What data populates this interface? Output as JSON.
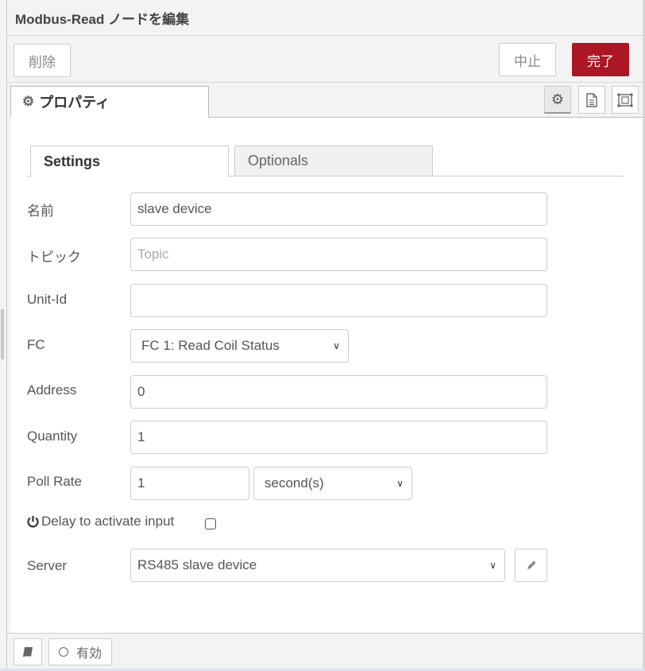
{
  "header": {
    "title": "Modbus-Read ノードを編集"
  },
  "toolbar": {
    "delete_label": "削除",
    "cancel_label": "中止",
    "done_label": "完了",
    "done_color": "#ad1625"
  },
  "tabs": {
    "properties_label": "プロパティ",
    "icons": [
      "gear-icon",
      "description-icon",
      "appearance-icon"
    ]
  },
  "subtabs": [
    {
      "label": "Settings",
      "active": true
    },
    {
      "label": "Optionals",
      "active": false
    }
  ],
  "form": {
    "name": {
      "label": "名前",
      "value": "slave device"
    },
    "topic": {
      "label": "トピック",
      "placeholder": "Topic",
      "value": ""
    },
    "unit_id": {
      "label": "Unit-Id",
      "value": ""
    },
    "fc": {
      "label": "FC",
      "value": "FC 1: Read Coil Status"
    },
    "address": {
      "label": "Address",
      "value": "0"
    },
    "quantity": {
      "label": "Quantity",
      "value": "1"
    },
    "poll_rate": {
      "label": "Poll Rate",
      "value": "1",
      "unit": "second(s)"
    },
    "delay": {
      "label": "Delay to activate input",
      "checked": false
    },
    "server": {
      "label": "Server",
      "value": "RS485 slave device"
    }
  },
  "footer": {
    "enable_label": "有効"
  }
}
